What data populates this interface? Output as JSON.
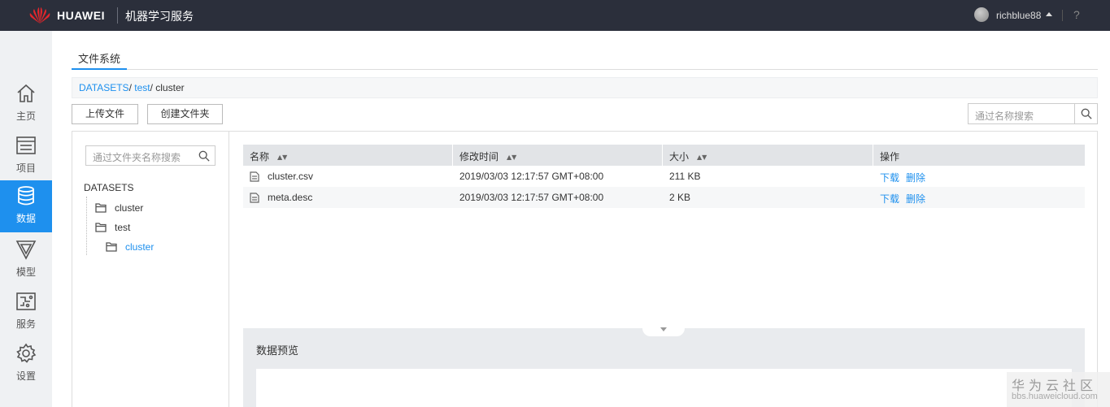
{
  "topbar": {
    "brand": "HUAWEI",
    "app_title": "机器学习服务",
    "username": "richblue88",
    "help": "?"
  },
  "nav": [
    {
      "label": "主页",
      "icon": "home-icon"
    },
    {
      "label": "项目",
      "icon": "project-icon"
    },
    {
      "label": "数据",
      "icon": "database-icon"
    },
    {
      "label": "模型",
      "icon": "model-icon"
    },
    {
      "label": "服务",
      "icon": "service-icon"
    },
    {
      "label": "设置",
      "icon": "gear-icon"
    }
  ],
  "active_nav": "数据",
  "tabs": {
    "file_system": "文件系统"
  },
  "breadcrumb": {
    "part1": "DATASETS",
    "part2": "test",
    "current": "cluster",
    "sep": "/ "
  },
  "toolbar": {
    "upload": "上传文件",
    "create_folder": "创建文件夹",
    "search_placeholder": "通过名称搜索"
  },
  "tree": {
    "search_placeholder": "通过文件夹名称搜索",
    "root": "DATASETS",
    "nodes": [
      "cluster",
      "test",
      "cluster"
    ]
  },
  "table": {
    "headers": {
      "name": "名称",
      "modified": "修改时间",
      "size": "大小",
      "ops": "操作"
    },
    "rows": [
      {
        "name": "cluster.csv",
        "modified": "2019/03/03 12:17:57 GMT+08:00",
        "size": "211 KB"
      },
      {
        "name": "meta.desc",
        "modified": "2019/03/03 12:17:57 GMT+08:00",
        "size": "2 KB"
      }
    ],
    "op_download": "下载",
    "op_delete": "删除"
  },
  "preview": {
    "title": "数据预览"
  },
  "watermark": {
    "title": "华为云社区",
    "url": "bbs.huaweicloud.com"
  },
  "colors": {
    "accent": "#1e90ee",
    "topbar": "#2b2f3b",
    "nav_bg": "#eff1f3",
    "logo_red": "#e3262c"
  }
}
